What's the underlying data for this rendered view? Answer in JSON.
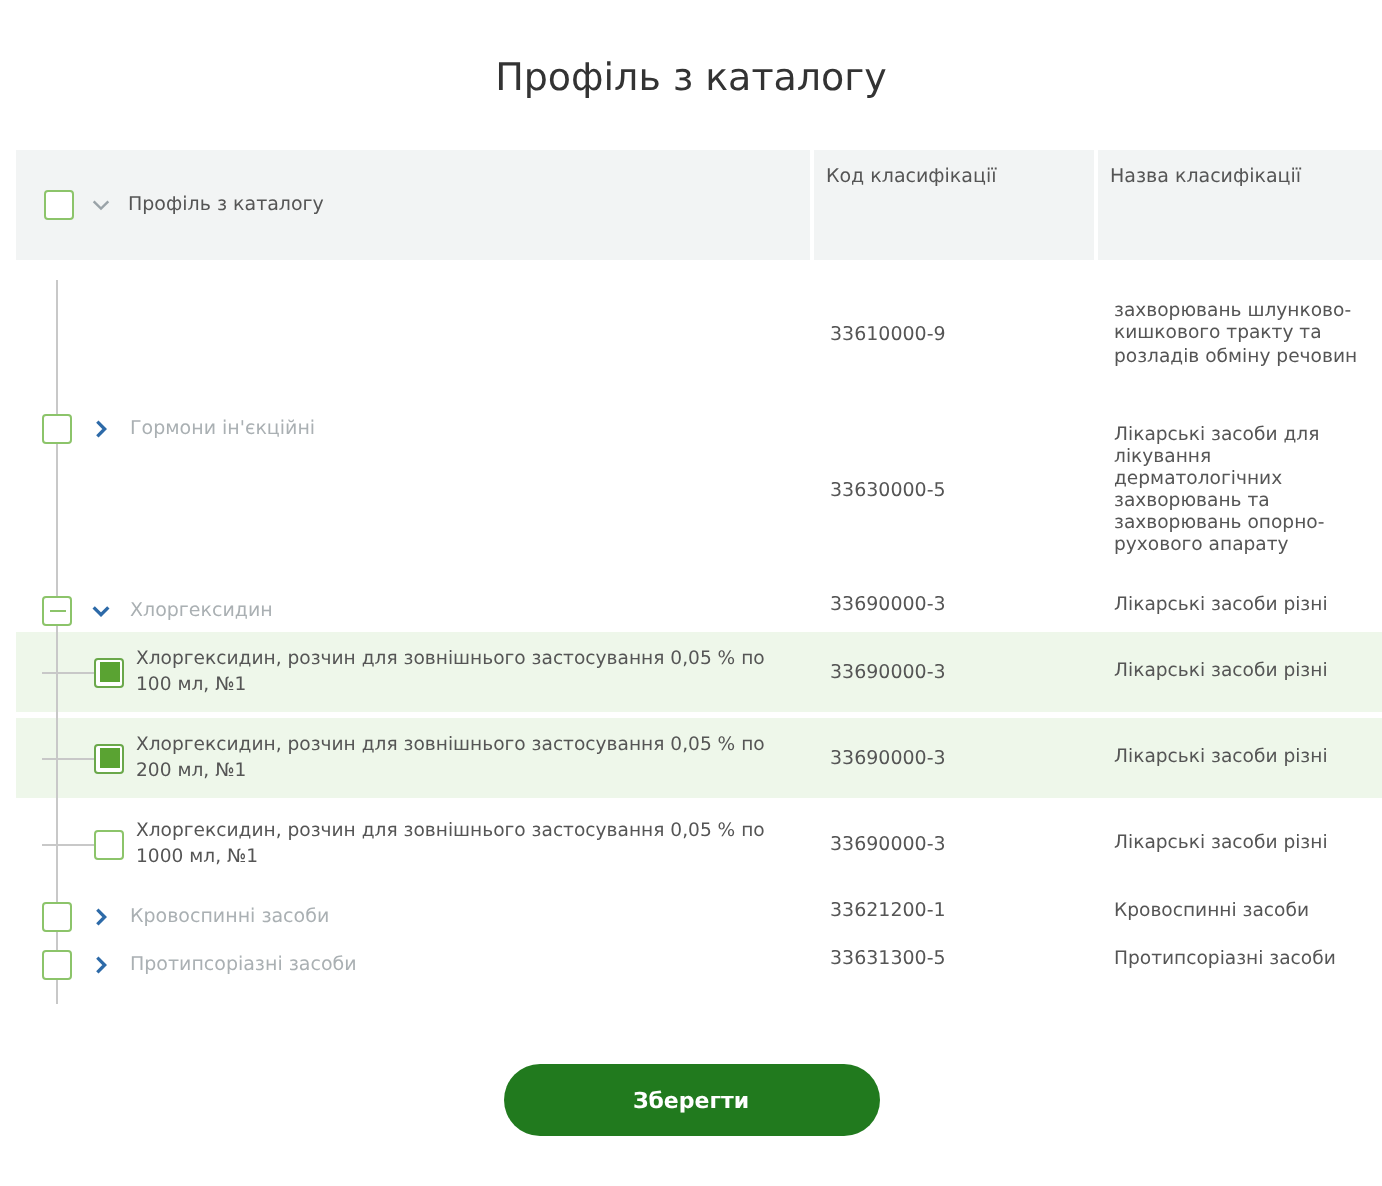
{
  "title": "Профіль з каталогу",
  "table": {
    "header": {
      "checked": false,
      "expanded": true,
      "label": "Профіль з каталогу"
    },
    "columns": [
      "Код класифікації",
      "Назва класифікації"
    ],
    "rows": [
      {
        "kind": "partial",
        "code": "33610000-9",
        "name": "захворювань шлунково-кишкового тракту та розладів обміну речовин"
      },
      {
        "kind": "group",
        "label": "Гормони ін'єкційні",
        "indeterminate": false,
        "expanded": false,
        "code": "33630000-5",
        "name": "Лікарські засоби для лікування дерматологічних захворювань та захворювань опорно-рухового апарату"
      },
      {
        "kind": "group",
        "label": "Хлоргексидин",
        "indeterminate": true,
        "expanded": true,
        "code": "33690000-3",
        "name": "Лікарські засоби різні"
      },
      {
        "kind": "item",
        "label": "Хлоргексидин, розчин для зовнішнього застосування 0,05 % по 100 мл, №1",
        "checked": true,
        "code": "33690000-3",
        "name": "Лікарські засоби різні"
      },
      {
        "kind": "item",
        "label": "Хлоргексидин, розчин для зовнішнього застосування 0,05 % по 200 мл, №1",
        "checked": true,
        "code": "33690000-3",
        "name": "Лікарські засоби різні"
      },
      {
        "kind": "item",
        "label": "Хлоргексидин, розчин для зовнішнього застосування 0,05 % по 1000 мл, №1",
        "checked": false,
        "code": "33690000-3",
        "name": "Лікарські засоби різні"
      },
      {
        "kind": "group",
        "label": "Кровоспинні засоби",
        "indeterminate": false,
        "expanded": false,
        "code": "33621200-1",
        "name": "Кровоспинні засоби"
      },
      {
        "kind": "group",
        "label": "Протипсоріазні засоби",
        "indeterminate": false,
        "expanded": false,
        "code": "33631300-5",
        "name": "Протипсоріазні засоби"
      }
    ]
  },
  "save_button": "Зберегти"
}
